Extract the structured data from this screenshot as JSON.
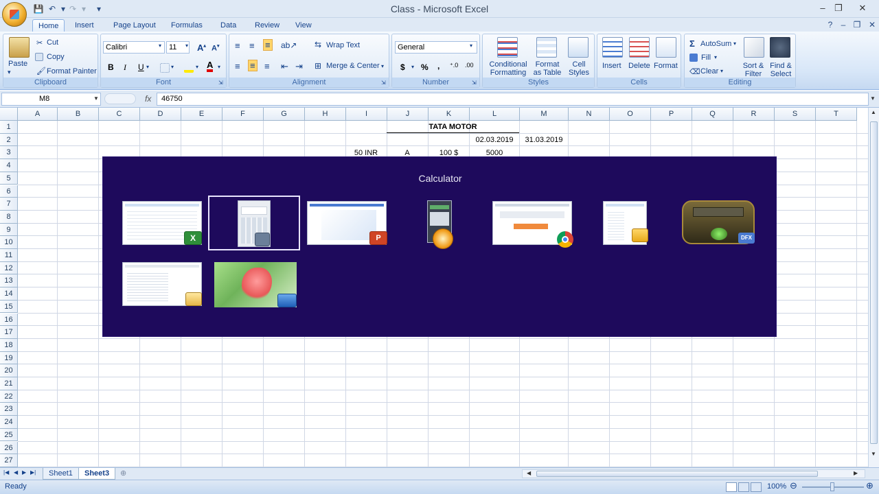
{
  "window": {
    "title": "Class - Microsoft Excel"
  },
  "ribbon_tabs": [
    "Home",
    "Insert",
    "Page Layout",
    "Formulas",
    "Data",
    "Review",
    "View"
  ],
  "clipboard": {
    "paste": "Paste",
    "cut": "Cut",
    "copy": "Copy",
    "format_painter": "Format Painter",
    "label": "Clipboard"
  },
  "font": {
    "name": "Calibri",
    "size": "11",
    "bold": "B",
    "italic": "I",
    "underline": "U",
    "label": "Font"
  },
  "alignment": {
    "wrap_text": "Wrap Text",
    "merge_center": "Merge & Center",
    "label": "Alignment"
  },
  "number": {
    "format": "General",
    "currency": "$",
    "percent": "%",
    "comma": ",",
    "label": "Number"
  },
  "styles": {
    "conditional": "Conditional Formatting",
    "format_table": "Format as Table",
    "cell_styles": "Cell Styles",
    "label": "Styles"
  },
  "cells": {
    "insert": "Insert",
    "delete": "Delete",
    "format": "Format",
    "label": "Cells"
  },
  "editing": {
    "autosum": "AutoSum",
    "fill": "Fill",
    "clear": "Clear",
    "sort_filter": "Sort & Filter",
    "find_select": "Find & Select",
    "label": "Editing"
  },
  "formula_bar": {
    "name_box": "M8",
    "fx": "fx",
    "value": "46750"
  },
  "columns": [
    "A",
    "B",
    "C",
    "D",
    "E",
    "F",
    "G",
    "H",
    "I",
    "J",
    "K",
    "L",
    "M",
    "N",
    "O",
    "P",
    "Q",
    "R",
    "S",
    "T"
  ],
  "rows": [
    "1",
    "2",
    "3",
    "4",
    "5",
    "6",
    "7",
    "8",
    "9",
    "10",
    "11",
    "12",
    "13",
    "14",
    "15",
    "16",
    "17",
    "18",
    "19",
    "20",
    "21",
    "22",
    "23",
    "24",
    "25",
    "26",
    "27"
  ],
  "cells_data": {
    "title": "TATA MOTOR",
    "date1": "02.03.2019",
    "date2": "31.03.2019",
    "i3": "50 INR",
    "j3": "A",
    "k3": "100 $",
    "l3": "5000"
  },
  "sheets": [
    "Sheet1",
    "Sheet3"
  ],
  "active_sheet": "Sheet3",
  "status": {
    "ready": "Ready",
    "zoom": "100%"
  },
  "switcher": {
    "title": "Calculator",
    "windows": [
      "excel-window",
      "calculator-window",
      "powerpoint-window",
      "app-window",
      "chrome-window",
      "folder-window",
      "media-player-window",
      "explorer-window",
      "desktop-window"
    ]
  }
}
